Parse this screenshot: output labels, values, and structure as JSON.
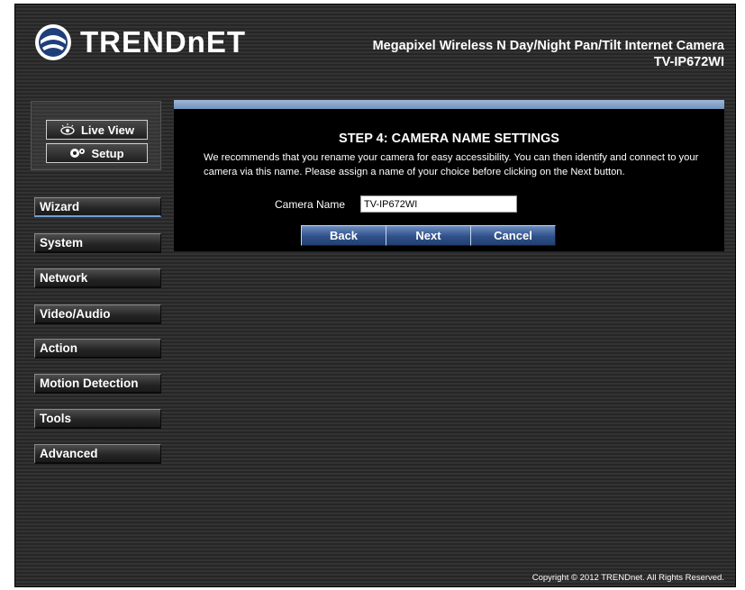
{
  "header": {
    "logo_text": "TRENDnET",
    "product_title": "Megapixel Wireless N Day/Night Pan/Tilt Internet Camera",
    "product_model": "TV-IP672WI"
  },
  "view_buttons": {
    "live_view": "Live View",
    "setup": "Setup"
  },
  "menu": {
    "items": [
      {
        "label": "Wizard",
        "active": true
      },
      {
        "label": "System"
      },
      {
        "label": "Network"
      },
      {
        "label": "Video/Audio"
      },
      {
        "label": "Action"
      },
      {
        "label": "Motion Detection"
      },
      {
        "label": "Tools"
      },
      {
        "label": "Advanced"
      }
    ]
  },
  "wizard": {
    "step_title": "STEP 4: CAMERA NAME SETTINGS",
    "description": "We recommends that you rename your camera for easy accessibility. You can then identify and connect to your camera via this name. Please assign a name of your choice before clicking on the Next button.",
    "camera_name_label": "Camera Name",
    "camera_name_value": "TV-IP672WI",
    "back_label": "Back",
    "next_label": "Next",
    "cancel_label": "Cancel"
  },
  "footer": {
    "copyright": "Copyright © 2012 TRENDnet. All Rights Reserved."
  },
  "colors": {
    "accent_blue": "#30508a",
    "active_underline": "#6fa0d8",
    "panel_bg": "#000000"
  }
}
